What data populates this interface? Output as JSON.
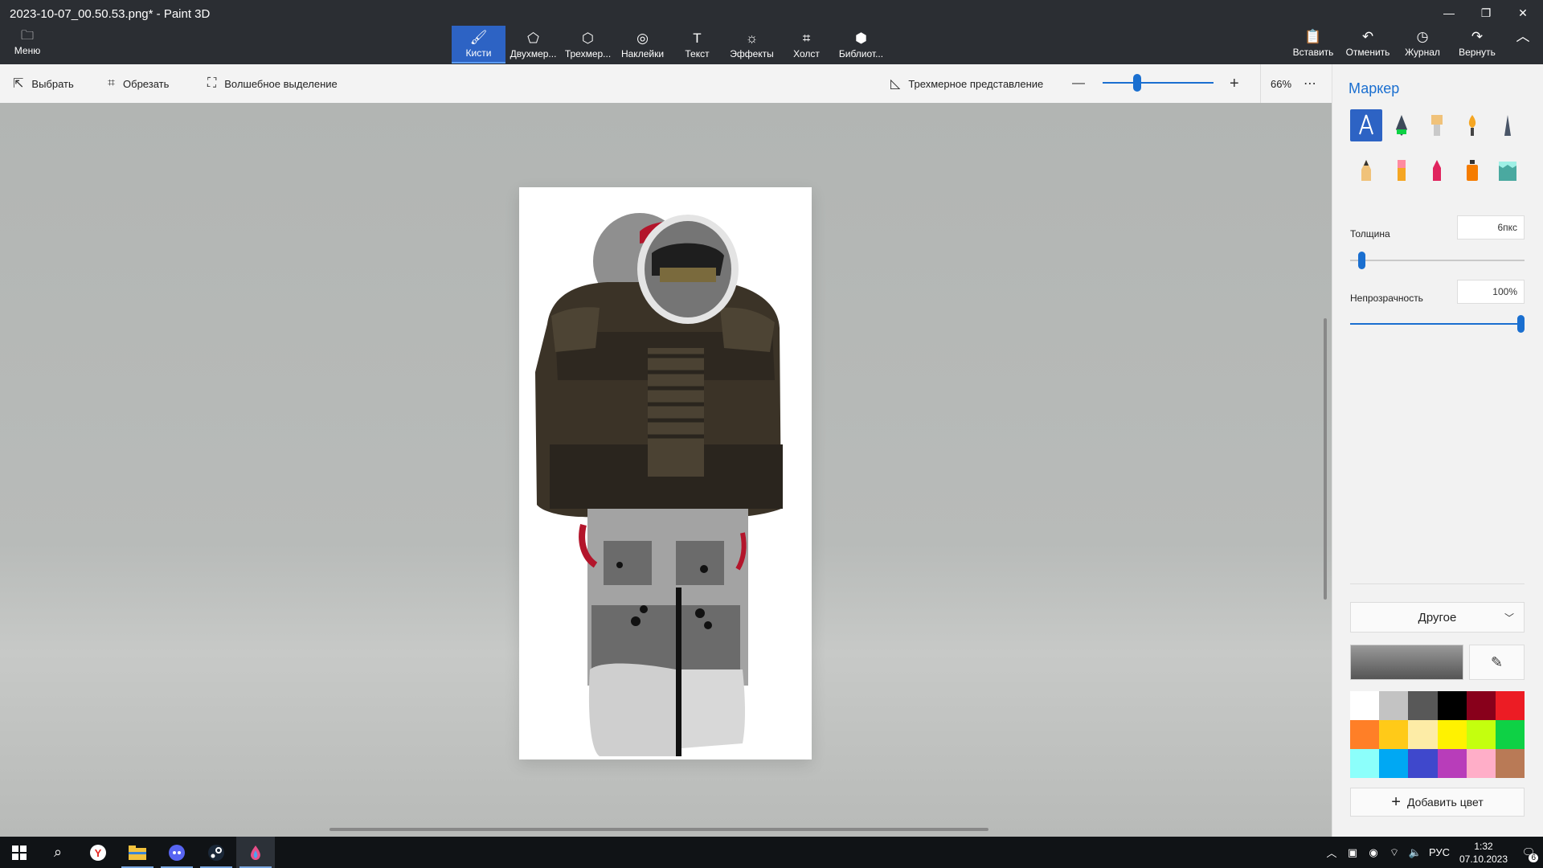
{
  "window": {
    "title": "2023-10-07_00.50.53.png* - Paint 3D"
  },
  "ribbon": {
    "menu_label": "Меню",
    "tools": [
      {
        "label": "Кисти",
        "icon": "brush-icon"
      },
      {
        "label": "Двухмер...",
        "icon": "2d-shapes-icon"
      },
      {
        "label": "Трехмер...",
        "icon": "3d-shapes-icon"
      },
      {
        "label": "Наклейки",
        "icon": "stickers-icon"
      },
      {
        "label": "Текст",
        "icon": "text-icon"
      },
      {
        "label": "Эффекты",
        "icon": "effects-icon"
      },
      {
        "label": "Холст",
        "icon": "canvas-icon"
      },
      {
        "label": "Библиот...",
        "icon": "library-icon"
      }
    ],
    "right_tools": [
      {
        "label": "Вставить",
        "icon": "paste-icon"
      },
      {
        "label": "Отменить",
        "icon": "undo-icon"
      },
      {
        "label": "Журнал",
        "icon": "history-icon"
      },
      {
        "label": "Вернуть",
        "icon": "redo-icon"
      }
    ]
  },
  "cmdbar": {
    "select_label": "Выбрать",
    "crop_label": "Обрезать",
    "magic_label": "Волшебное выделение",
    "view3d_label": "Трехмерное представление",
    "zoom_percent": "66%"
  },
  "panel": {
    "title": "Маркер",
    "thickness_label": "Толщина",
    "thickness_value": "6пкс",
    "thickness_fraction": 0.05,
    "opacity_label": "Непрозрачность",
    "opacity_value": "100%",
    "opacity_fraction": 1.0,
    "color_dropdown": "Другое",
    "add_color_label": "Добавить цвет",
    "accent_color": "#1a6fd0",
    "swatches": [
      "#ffffff",
      "#c3c3c3",
      "#585858",
      "#000000",
      "#88001b",
      "#ec1c24",
      "#ff7f27",
      "#ffca18",
      "#fdeca6",
      "#fff200",
      "#c4ff0e",
      "#0ed145",
      "#8cfffb",
      "#00a8f3",
      "#3f48cc",
      "#b83dba",
      "#ffaec8",
      "#b97a56"
    ]
  },
  "taskbar": {
    "lang": "РУС",
    "time": "1:32",
    "date": "07.10.2023",
    "notifications": "6"
  }
}
